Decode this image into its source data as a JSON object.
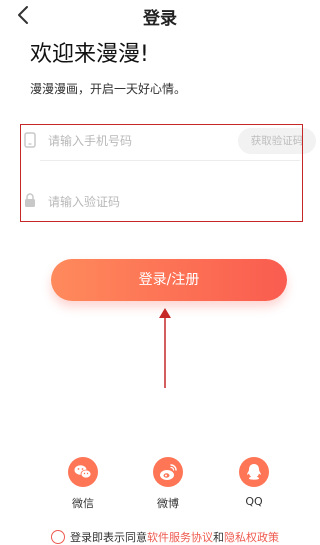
{
  "header": {
    "title": "登录"
  },
  "welcome": {
    "heading": "欢迎来漫漫!",
    "subtitle": "漫漫漫画，开启一天好心情。"
  },
  "form": {
    "phone_placeholder": "请输入手机号码",
    "code_placeholder": "请输入验证码",
    "get_code_label": "获取验证码"
  },
  "login_button": {
    "label": "登录/注册"
  },
  "social": [
    {
      "label": "微信",
      "icon": "wechat-icon"
    },
    {
      "label": "微博",
      "icon": "weibo-icon"
    },
    {
      "label": "QQ",
      "icon": "qq-icon"
    }
  ],
  "agreement": {
    "prefix": "登录即表示同意",
    "service_link": "软件服务协议",
    "and": "和",
    "privacy_link": "隐私权政策"
  },
  "colors": {
    "accent": "#fa5c4f",
    "annotation": "#c62828"
  }
}
